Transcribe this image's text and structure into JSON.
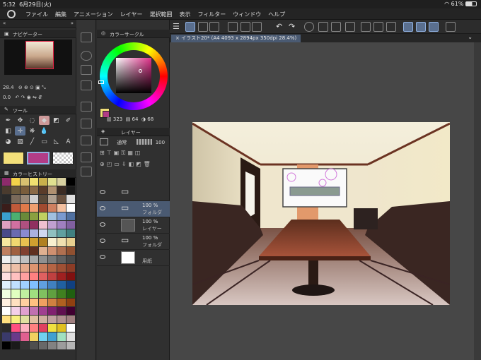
{
  "status": {
    "time": "5:32",
    "date": "6月29日(火)",
    "battery": "61%"
  },
  "menu": [
    "ファイル",
    "編集",
    "アニメーション",
    "レイヤー",
    "選択範囲",
    "表示",
    "フィルター",
    "ウィンドウ",
    "ヘルプ"
  ],
  "navigator": {
    "title": "ナビゲーター",
    "zoom": "28.4",
    "rotate": "0.0"
  },
  "tool_panel": {
    "title": "ツール"
  },
  "history_panel": {
    "title": "カラーヒストリー"
  },
  "color_circle": {
    "title": "カラーサークル",
    "hue": "323",
    "sat": "64",
    "val": "68"
  },
  "layer_panel": {
    "title": "レイヤー",
    "blend": "通常",
    "opacity": "100",
    "layers": [
      {
        "pct": "",
        "name": "",
        "kind": "folder"
      },
      {
        "pct": "100 %",
        "name": "フォルダ",
        "kind": "folder",
        "selected": true
      },
      {
        "pct": "100 %",
        "name": "レイヤー",
        "kind": "raster"
      },
      {
        "pct": "100 %",
        "name": "フォルダ",
        "kind": "folder"
      },
      {
        "pct": "",
        "name": "用紙",
        "kind": "paper"
      }
    ]
  },
  "document_tab": "イラスト20* (A4 4093 x 2894px 350dpi 28.4%)",
  "palette_colors": [
    "#8d2b6b",
    "#f3d24a",
    "#d8c070",
    "#f0e070",
    "#c9b04c",
    "#e0e090",
    "#d8d0a0",
    "#000000",
    "#4a3b2e",
    "#6b5a3e",
    "#7a5d3c",
    "#8a6a48",
    "#5a3c2a",
    "#b09070",
    "#3c2c24",
    "#1a1a1a",
    "#2a2a2a",
    "#7a6a5a",
    "#9a8a7a",
    "#d0d0d0",
    "#5a4a3a",
    "#b0a090",
    "#6a5240",
    "#e0e0e0",
    "#3a1d1a",
    "#c05a3a",
    "#e07a4a",
    "#f0a070",
    "#a04a30",
    "#d08060",
    "#f3c0a0",
    "#ffffff",
    "#3aa0d0",
    "#4cb070",
    "#6a8a3a",
    "#8aa040",
    "#c0d060",
    "#a0c0e0",
    "#7a9ad0",
    "#5070a0",
    "#e0a0c0",
    "#d070a0",
    "#b05080",
    "#903060",
    "#f0c0d0",
    "#c0a0d0",
    "#a080c0",
    "#8060a0",
    "#4a4a8a",
    "#6a6ab0",
    "#8a8ad0",
    "#aab0e0",
    "#d0d8f0",
    "#90c0c0",
    "#60a0a0",
    "#408080",
    "#f8e8a0",
    "#f0d870",
    "#e8c050",
    "#d0a030",
    "#b08020",
    "#f8f0d0",
    "#f0e0b0",
    "#e8d090",
    "#c08060",
    "#a06040",
    "#804030",
    "#603020",
    "#e0b090",
    "#d09070",
    "#b07050",
    "#905030",
    "#f0f0f0",
    "#d8d8d8",
    "#c0c0c0",
    "#a8a8a8",
    "#909090",
    "#787878",
    "#606060",
    "#484848",
    "#f7d7c4",
    "#eec0a8",
    "#e6aa8c",
    "#dd9470",
    "#c97a58",
    "#b56444",
    "#a05034",
    "#8c3c26",
    "#ffe0e0",
    "#ffc0c0",
    "#ffa0a0",
    "#ff8080",
    "#e06060",
    "#c04040",
    "#a02020",
    "#801010",
    "#e0f0ff",
    "#c0e0ff",
    "#a0d0ff",
    "#80c0ff",
    "#60a0e0",
    "#4080c0",
    "#2060a0",
    "#104080",
    "#f0ffe0",
    "#e0ffc0",
    "#c0f0a0",
    "#a0e080",
    "#80c060",
    "#60a040",
    "#408020",
    "#206010",
    "#fff0e0",
    "#ffe0c0",
    "#ffd0a0",
    "#ffc080",
    "#f0a060",
    "#d08040",
    "#b06020",
    "#904010",
    "#ffffff",
    "#f4d0e8",
    "#e0a0d0",
    "#c070b0",
    "#a04090",
    "#802070",
    "#601050",
    "#400030",
    "#ffe080",
    "#f8f080",
    "#e0e0a0",
    "#e0c0a0",
    "#d0b0a0",
    "#c0a0a0",
    "#b09090",
    "#a08080",
    "#2a2a2a",
    "#ff5080",
    "#ffb0c0",
    "#ff8080",
    "#e04060",
    "#f0e040",
    "#e0c020",
    "#ffffff",
    "#3a3a6a",
    "#6a3a8a",
    "#e06090",
    "#f0d060",
    "#70d0f0",
    "#40a0d0",
    "#a0e0c0",
    "#e0e0e0",
    "#000000",
    "#1a1a1a",
    "#343434",
    "#4e4e4e",
    "#686868",
    "#828282",
    "#9c9c9c",
    "#b6b6b6"
  ]
}
